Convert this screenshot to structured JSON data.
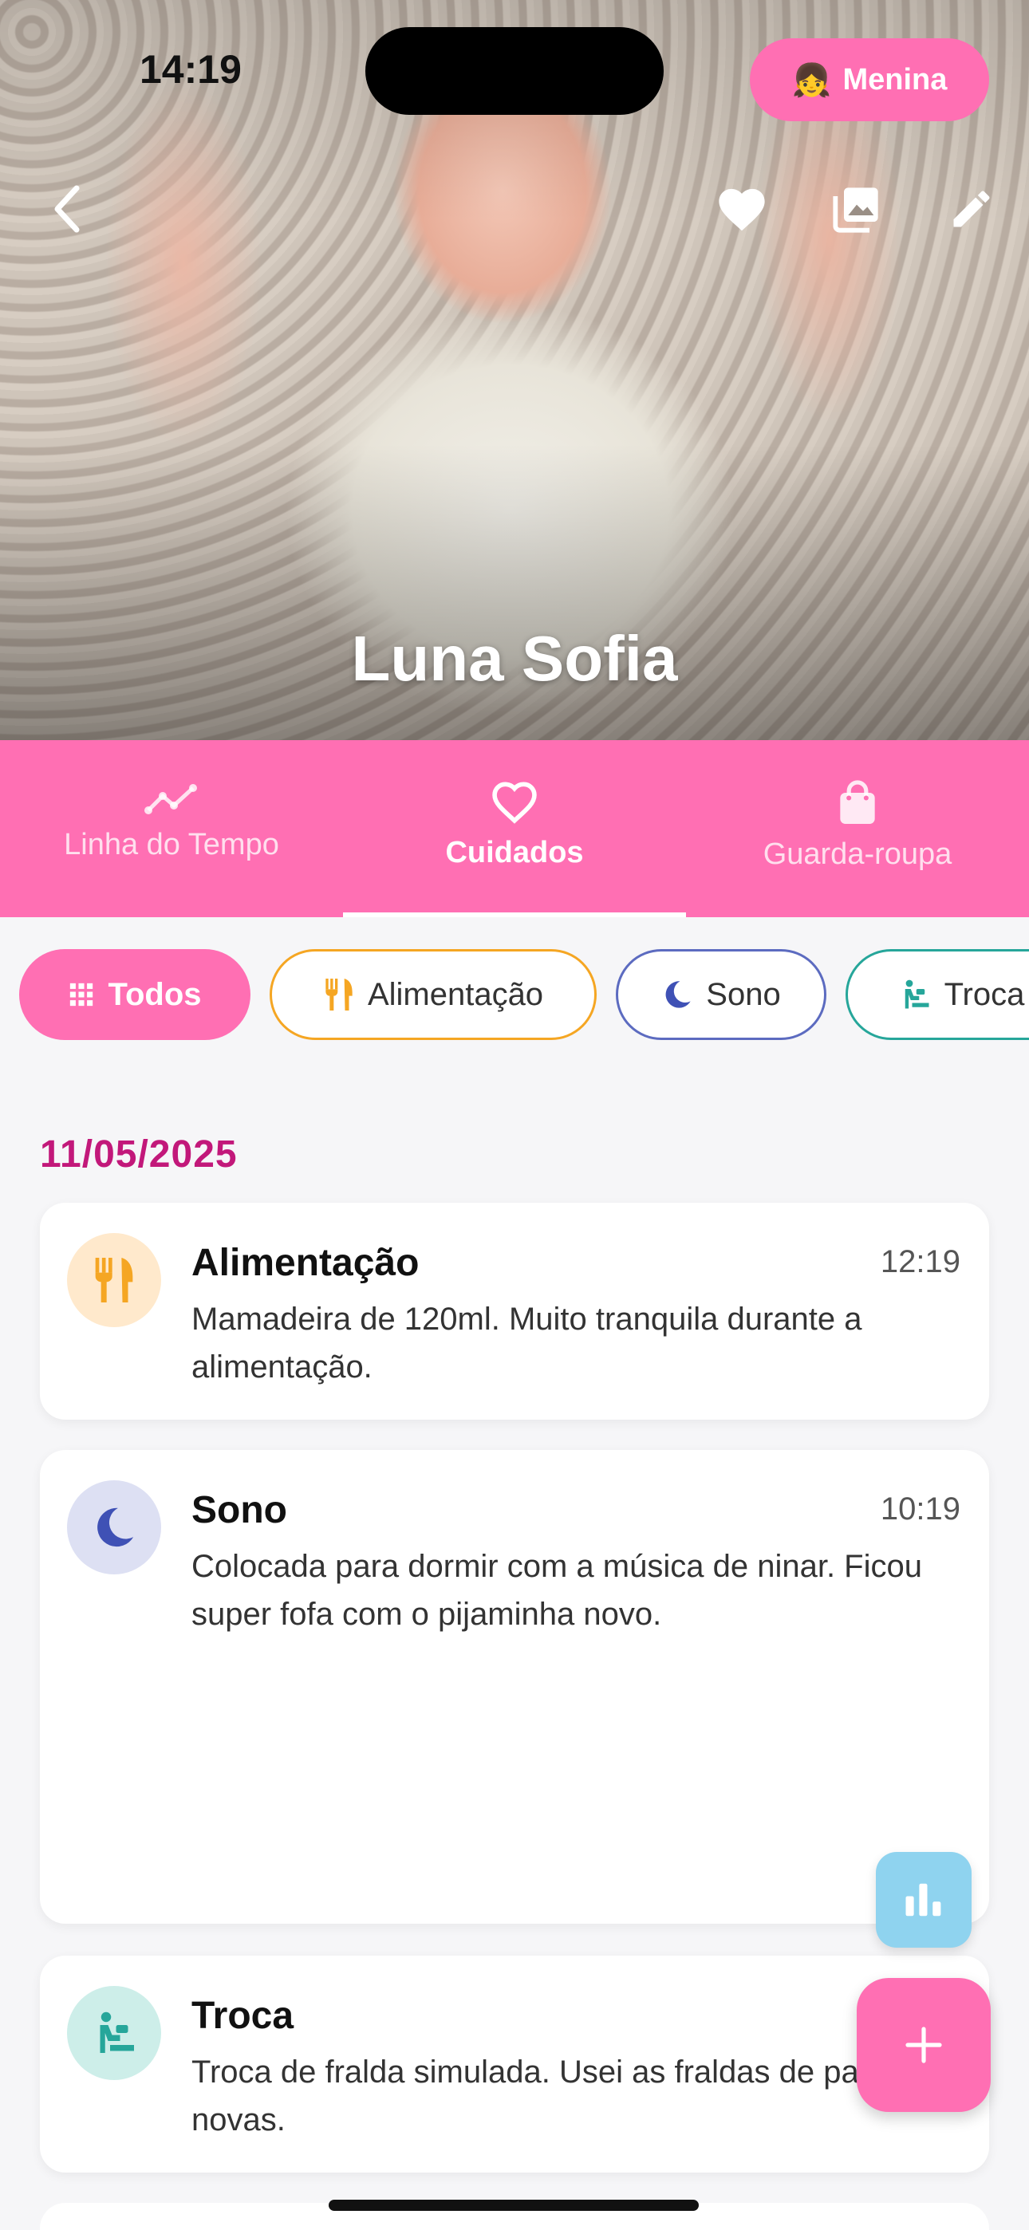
{
  "status_bar": {
    "time": "14:19"
  },
  "hero": {
    "gender_pill": {
      "emoji": "👧",
      "label": "Menina"
    },
    "baby_name": "Luna Sofia",
    "buttons": [
      "back-icon",
      "heart-icon",
      "gallery-icon",
      "edit-icon"
    ]
  },
  "tabs": [
    {
      "label": "Linha do Tempo",
      "icon": "timeline-icon",
      "active": false
    },
    {
      "label": "Cuidados",
      "icon": "heart-outline-icon",
      "active": true
    },
    {
      "label": "Guarda-roupa",
      "icon": "shopping-bag-icon",
      "active": false
    }
  ],
  "filters": [
    {
      "label": "Todos",
      "icon": "grid-icon",
      "selected": true,
      "color": "#ff6fb3"
    },
    {
      "label": "Alimentação",
      "icon": "fork-knife-icon",
      "selected": false,
      "color": "#f5a623"
    },
    {
      "label": "Sono",
      "icon": "moon-icon",
      "selected": false,
      "color": "#3f51b5"
    },
    {
      "label": "Troca",
      "icon": "baby-changing-icon",
      "selected": false,
      "color": "#26a69a"
    }
  ],
  "date_header": "11/05/2025",
  "entries": [
    {
      "category": "Alimentação",
      "time": "12:19",
      "text": "Mamadeira de 120ml. Muito tranquila durante a alimentação.",
      "icon": "fork-knife-icon",
      "color": "#f5a623",
      "bg": "#ffe9cc"
    },
    {
      "category": "Sono",
      "time": "10:19",
      "text": "Colocada para dormir com a música de ninar. Ficou super fofa com o pijaminha novo.",
      "icon": "moon-icon",
      "color": "#3f51b5",
      "bg": "#dde0f3"
    },
    {
      "category": "Troca",
      "time": "",
      "text": "Troca de fralda simulada. Usei as fraldas de pano novas.",
      "icon": "baby-changing-icon",
      "color": "#26a69a",
      "bg": "#cdeee9"
    }
  ],
  "fabs": {
    "stats": "bar-chart-icon",
    "add": "plus-icon"
  },
  "colors": {
    "primary": "#ff6fb3",
    "date": "#c2187a"
  }
}
